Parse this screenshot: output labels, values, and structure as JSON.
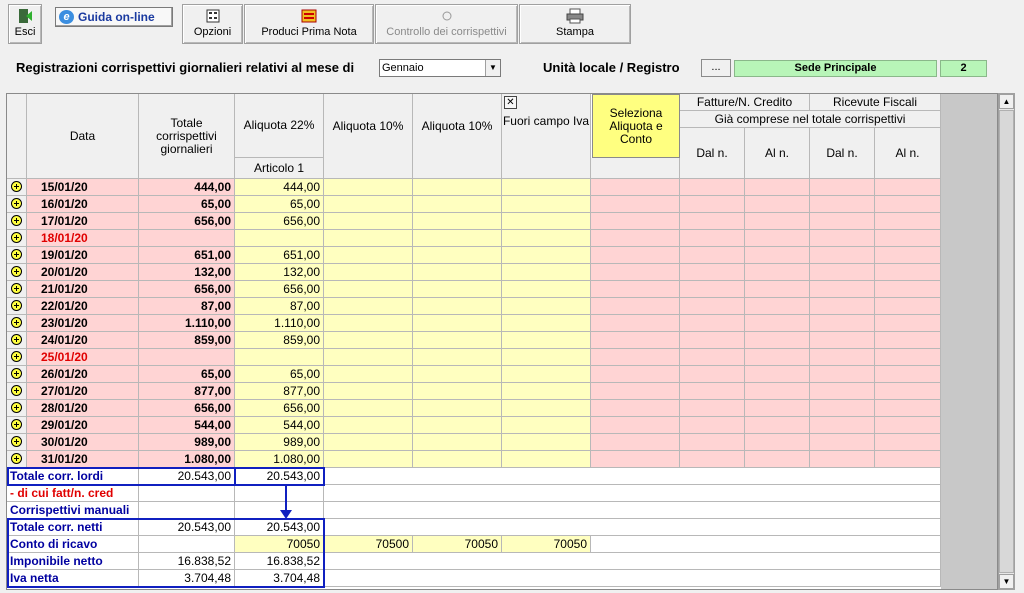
{
  "toolbar": {
    "esci": "Esci",
    "guida": "Guida on-line",
    "opzioni": "Opzioni",
    "produci": "Produci Prima Nota",
    "controllo": "Controllo dei corrispettivi",
    "stampa": "Stampa"
  },
  "filter": {
    "month_label": "Registrazioni corrispettivi giornalieri relativi al mese di",
    "month_value": "Gennaio",
    "unit_label": "Unità locale / Registro",
    "dots": "...",
    "sede": "Sede Principale",
    "registro": "2"
  },
  "headers": {
    "data": "Data",
    "totale": "Totale corrispettivi giornalieri",
    "aliquota22": "Aliquota 22%",
    "articolo": "Articolo 1",
    "aliquota10a": "Aliquota 10%",
    "aliquota10b": "Aliquota 10%",
    "fuori_campo": "Fuori campo Iva",
    "close_x": "✕",
    "seleziona": "Seleziona Aliquota e Conto",
    "fatture": "Fatture/N. Credito",
    "ricevute": "Ricevute Fiscali",
    "gia_comprese": "Già comprese nel totale corrispettivi",
    "dal1": "Dal n.",
    "al1": "Al n.",
    "dal2": "Dal n.",
    "al2": "Al n."
  },
  "rows": [
    {
      "date": "15/01/20",
      "tot": "444,00",
      "a22": "444,00",
      "holiday": false
    },
    {
      "date": "16/01/20",
      "tot": "65,00",
      "a22": "65,00",
      "holiday": false
    },
    {
      "date": "17/01/20",
      "tot": "656,00",
      "a22": "656,00",
      "holiday": false
    },
    {
      "date": "18/01/20",
      "tot": "",
      "a22": "",
      "holiday": true
    },
    {
      "date": "19/01/20",
      "tot": "651,00",
      "a22": "651,00",
      "holiday": false
    },
    {
      "date": "20/01/20",
      "tot": "132,00",
      "a22": "132,00",
      "holiday": false
    },
    {
      "date": "21/01/20",
      "tot": "656,00",
      "a22": "656,00",
      "holiday": false
    },
    {
      "date": "22/01/20",
      "tot": "87,00",
      "a22": "87,00",
      "holiday": false
    },
    {
      "date": "23/01/20",
      "tot": "1.110,00",
      "a22": "1.110,00",
      "holiday": false
    },
    {
      "date": "24/01/20",
      "tot": "859,00",
      "a22": "859,00",
      "holiday": false
    },
    {
      "date": "25/01/20",
      "tot": "",
      "a22": "",
      "holiday": true
    },
    {
      "date": "26/01/20",
      "tot": "65,00",
      "a22": "65,00",
      "holiday": false
    },
    {
      "date": "27/01/20",
      "tot": "877,00",
      "a22": "877,00",
      "holiday": false
    },
    {
      "date": "28/01/20",
      "tot": "656,00",
      "a22": "656,00",
      "holiday": false
    },
    {
      "date": "29/01/20",
      "tot": "544,00",
      "a22": "544,00",
      "holiday": false
    },
    {
      "date": "30/01/20",
      "tot": "989,00",
      "a22": "989,00",
      "holiday": false
    },
    {
      "date": "31/01/20",
      "tot": "1.080,00",
      "a22": "1.080,00",
      "holiday": false
    }
  ],
  "summary": {
    "lordi_label": "Totale corr. lordi",
    "lordi_tot": "20.543,00",
    "lordi_a22": "20.543,00",
    "fatt_label": "- di cui fatt/n. cred",
    "manuali_label": "Corrispettivi manuali",
    "netti_label": "Totale corr. netti",
    "netti_tot": "20.543,00",
    "netti_a22": "20.543,00",
    "conto_label": "Conto di ricavo",
    "conto_a22": "70050",
    "conto_a10a": "70500",
    "conto_a10b": "70050",
    "conto_fc": "70050",
    "imponibile_label": "Imponibile netto",
    "imponibile_tot": "16.838,52",
    "imponibile_a22": "16.838,52",
    "iva_label": "Iva netta",
    "iva_tot": "3.704,48",
    "iva_a22": "3.704,48"
  },
  "colors": {
    "pink_row": "#ffd4d4",
    "yellow_cell": "#ffffc0",
    "highlight_yellow": "#ffff80",
    "sede_green": "#b8f5b8",
    "label_blue": "#0000a0",
    "holiday_red": "#e00000"
  }
}
